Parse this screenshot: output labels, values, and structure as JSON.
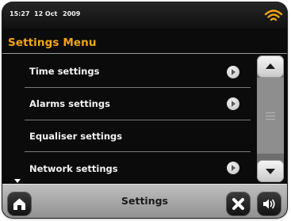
{
  "status_bar": {
    "time": "15:27",
    "date": "12 Oct",
    "year": "2009",
    "wifi_icon": "wifi-signal-icon",
    "wifi_color": "#f2a60c"
  },
  "menu": {
    "title": "Settings Menu",
    "title_color": "#f2a60c",
    "items": [
      {
        "label": "Time settings",
        "has_arrow": true
      },
      {
        "label": "Alarms settings",
        "has_arrow": true
      },
      {
        "label": "Equaliser settings",
        "has_arrow": false
      },
      {
        "label": "Network settings",
        "has_arrow": true
      }
    ],
    "more_indicator_icon": "more-below-triangle-icon"
  },
  "scrollbar": {
    "up_icon": "scroll-up-icon",
    "down_icon": "scroll-down-icon"
  },
  "bottom_bar": {
    "title": "Settings",
    "home_icon": "home-icon",
    "close_icon": "close-icon",
    "volume_icon": "volume-icon"
  }
}
